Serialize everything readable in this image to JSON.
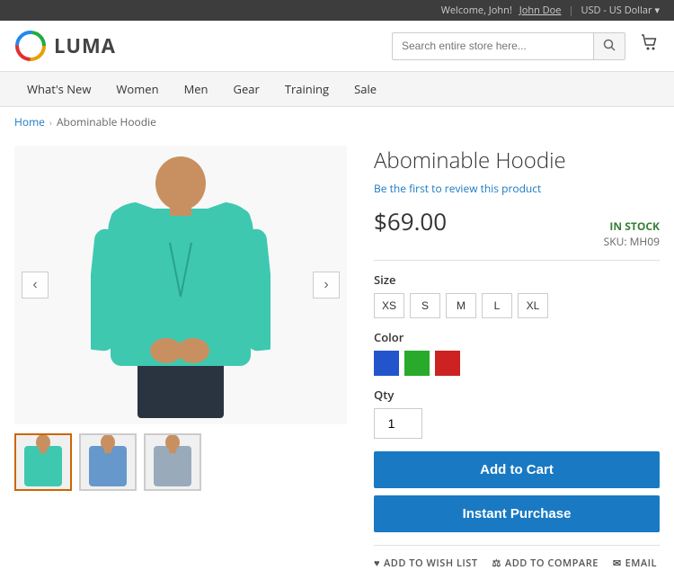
{
  "topbar": {
    "welcome": "Welcome, John!",
    "user": "John Doe",
    "currency": "USD - US Dollar",
    "currency_arrow": "▾"
  },
  "header": {
    "logo_text": "LUMA",
    "search_placeholder": "Search entire store here...",
    "cart_icon": "🛒"
  },
  "nav": {
    "items": [
      {
        "label": "What's New"
      },
      {
        "label": "Women"
      },
      {
        "label": "Men"
      },
      {
        "label": "Gear"
      },
      {
        "label": "Training"
      },
      {
        "label": "Sale"
      }
    ]
  },
  "breadcrumb": {
    "home": "Home",
    "current": "Abominable Hoodie"
  },
  "product": {
    "title": "Abominable Hoodie",
    "review_link": "Be the first to review this product",
    "price": "$69.00",
    "stock_status": "IN STOCK",
    "sku_label": "SKU:",
    "sku": "MH09",
    "size_label": "Size",
    "sizes": [
      "XS",
      "S",
      "M",
      "L",
      "XL"
    ],
    "color_label": "Color",
    "colors": [
      {
        "name": "Blue",
        "class": "blue"
      },
      {
        "name": "Green",
        "class": "green"
      },
      {
        "name": "Red",
        "class": "red"
      }
    ],
    "qty_label": "Qty",
    "qty_value": "1",
    "add_to_cart_label": "Add to Cart",
    "instant_purchase_label": "Instant Purchase",
    "wishlist_label": "ADD TO WISH LIST",
    "compare_label": "ADD TO COMPARE",
    "email_label": "EMAIL"
  }
}
